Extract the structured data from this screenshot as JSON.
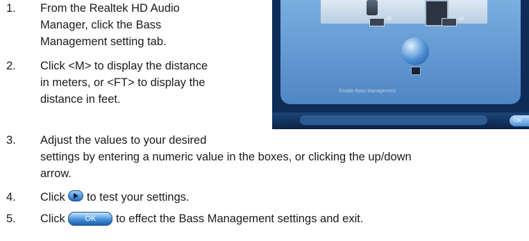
{
  "steps": [
    {
      "number": "1.",
      "lines": [
        "From the Realtek HD Audio",
        "Manager, click the Bass",
        "Management setting tab."
      ]
    },
    {
      "number": "2.",
      "lines": [
        "Click <M> to display the distance",
        "in meters, or <FT> to display the",
        "distance in feet."
      ]
    },
    {
      "number": "3.",
      "lines": [
        "Adjust the values to your desired",
        "settings by entering a numeric value in the boxes, or clicking the up/down",
        "arrow."
      ]
    },
    {
      "number": "4.",
      "before": "Click",
      "after": "to test your settings.",
      "icon": "play-button-icon"
    },
    {
      "number": "5.",
      "before": "Click",
      "after": "to effect the Bass Management settings and exit.",
      "icon": "ok-button-icon",
      "button_label": "OK"
    }
  ],
  "screenshot": {
    "left_channel": "L",
    "right_channel": "R",
    "db_unit": "dB",
    "enable_label": "Enable Bass Management",
    "ok_label": "OK"
  }
}
